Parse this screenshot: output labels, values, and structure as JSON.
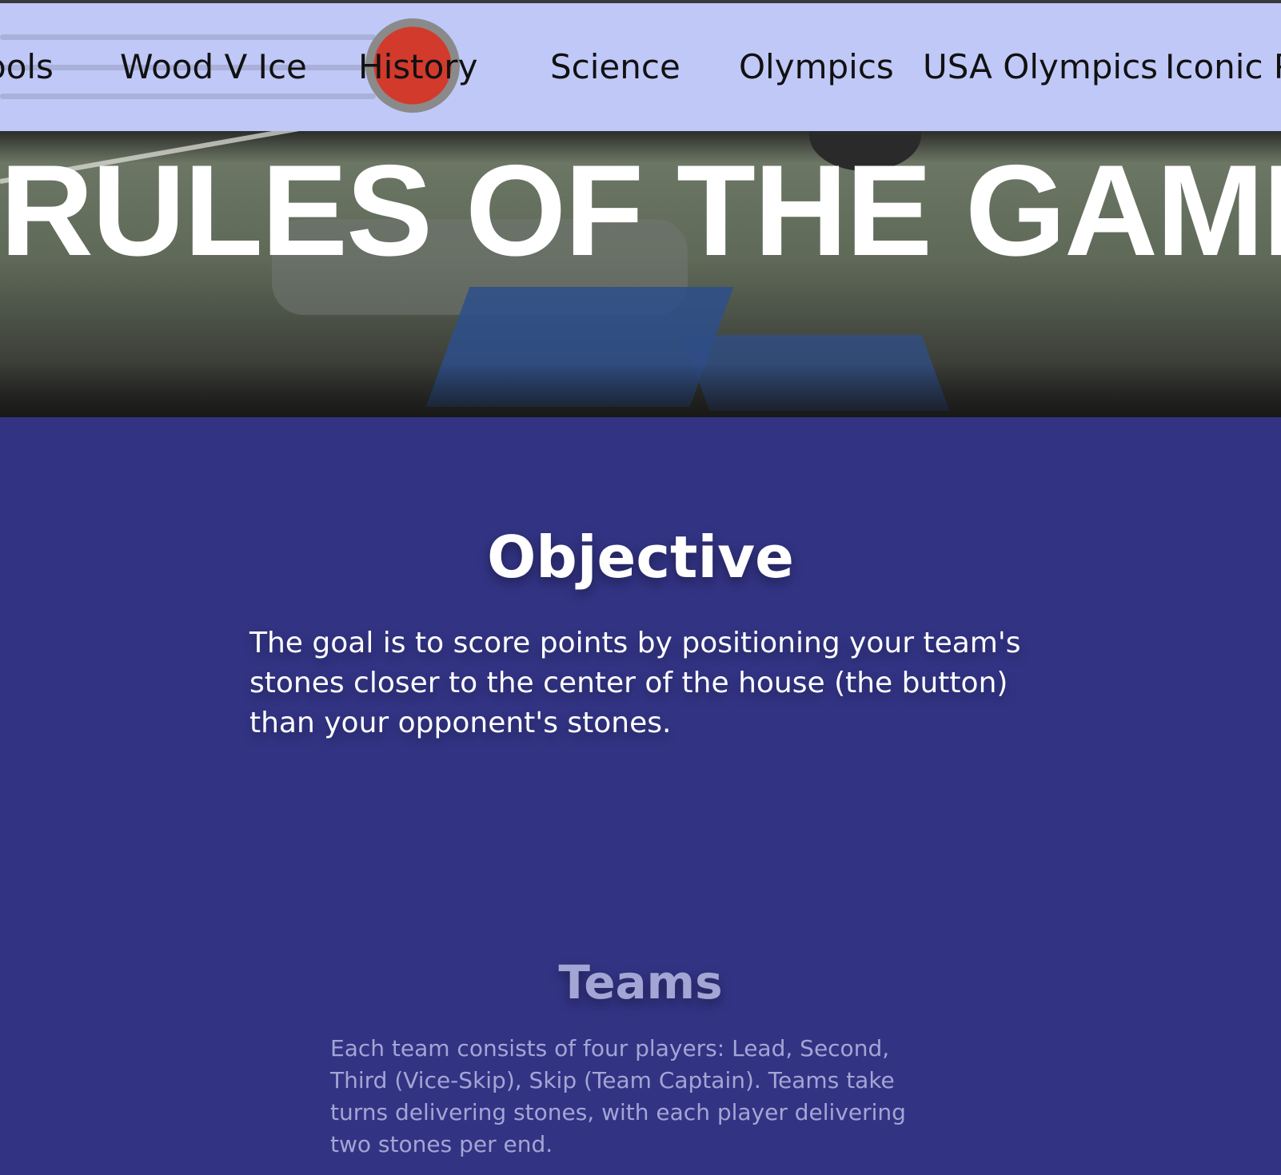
{
  "nav": {
    "items": [
      {
        "label": "ools"
      },
      {
        "label": "Wood V Ice"
      },
      {
        "label": "History"
      },
      {
        "label": "Science"
      },
      {
        "label": "Olympics"
      },
      {
        "label": "USA Olympics"
      },
      {
        "label": "Iconic P"
      }
    ],
    "active_marker_color": "#d23a2c"
  },
  "hero": {
    "title": "RULES OF THE GAME"
  },
  "sections": {
    "objective": {
      "heading": "Objective",
      "body": "The goal is to score points by positioning your team's stones closer to the center of the house (the button) than your opponent's stones."
    },
    "teams": {
      "heading": "Teams",
      "body": "Each team consists of four players: Lead, Second, Third (Vice-Skip), Skip (Team Captain). Teams take turns delivering stones, with each player delivering two stones per end."
    }
  },
  "colors": {
    "nav_background": "#c0c8f8",
    "page_background": "#323383",
    "faded_text": "#a3a5d5"
  }
}
